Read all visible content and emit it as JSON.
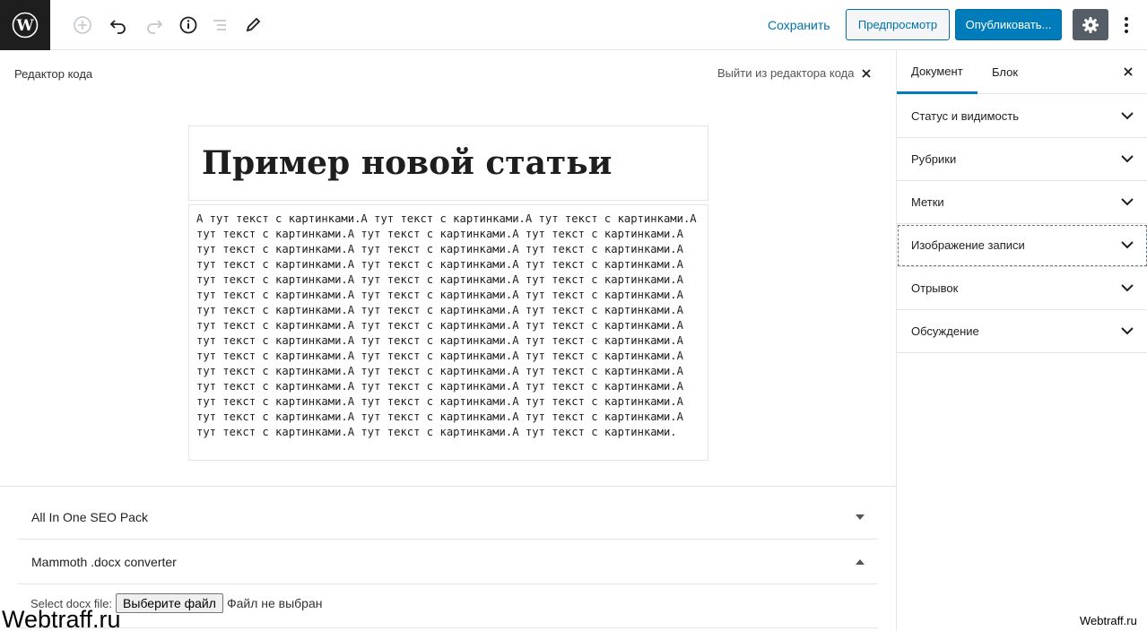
{
  "toolbar": {
    "save_label": "Сохранить",
    "preview_label": "Предпросмотр",
    "publish_label": "Опубликовать..."
  },
  "editor": {
    "mode_label": "Редактор кода",
    "exit_label": "Выйти из редактора кода",
    "title": "Пример новой статьи",
    "content": "А тут текст с картинками.А тут текст с картинками.А тут текст с картинками.А тут текст с картинками.А тут текст с картинками.А тут текст с картинками.А тут текст с картинками.А тут текст с картинками.А тут текст с картинками.А тут текст с картинками.А тут текст с картинками.А тут текст с картинками.А тут текст с картинками.А тут текст с картинками.А тут текст с картинками.А тут текст с картинками.А тут текст с картинками.А тут текст с картинками.А тут текст с картинками.А тут текст с картинками.А тут текст с картинками.А тут текст с картинками.А тут текст с картинками.А тут текст с картинками.А тут текст с картинками.А тут текст с картинками.А тут текст с картинками.А тут текст с картинками.А тут текст с картинками.А тут текст с картинками.А тут текст с картинками.А тут текст с картинками.А тут текст с картинками.А тут текст с картинками.А тут текст с картинками.А тут текст с картинками.А тут текст с картинками.А тут текст с картинками.А тут текст с картинками.А тут текст с картинками.А тут текст с картинками.А тут текст с картинками.А тут текст с картинками.А тут текст с картинками.А тут текст с картинками."
  },
  "meta_boxes": [
    {
      "label": "All In One SEO Pack",
      "state": "collapsed"
    },
    {
      "label": "Mammoth .docx converter",
      "state": "expanded"
    }
  ],
  "docx": {
    "select_label": "Select docx file:",
    "choose_button": "Выберите файл",
    "no_file": "Файл не выбран"
  },
  "sidebar": {
    "tabs": [
      {
        "label": "Документ",
        "active": true
      },
      {
        "label": "Блок",
        "active": false
      }
    ],
    "panels": [
      {
        "label": "Статус и видимость"
      },
      {
        "label": "Рубрики"
      },
      {
        "label": "Метки"
      },
      {
        "label": "Изображение записи"
      },
      {
        "label": "Отрывок"
      },
      {
        "label": "Обсуждение"
      }
    ]
  },
  "watermark": {
    "left": "Webtraff.ru",
    "right": "Webtraff.ru"
  },
  "colors": {
    "accent": "#007cba",
    "dark": "#1e1e1e",
    "border": "#e2e4e7"
  }
}
